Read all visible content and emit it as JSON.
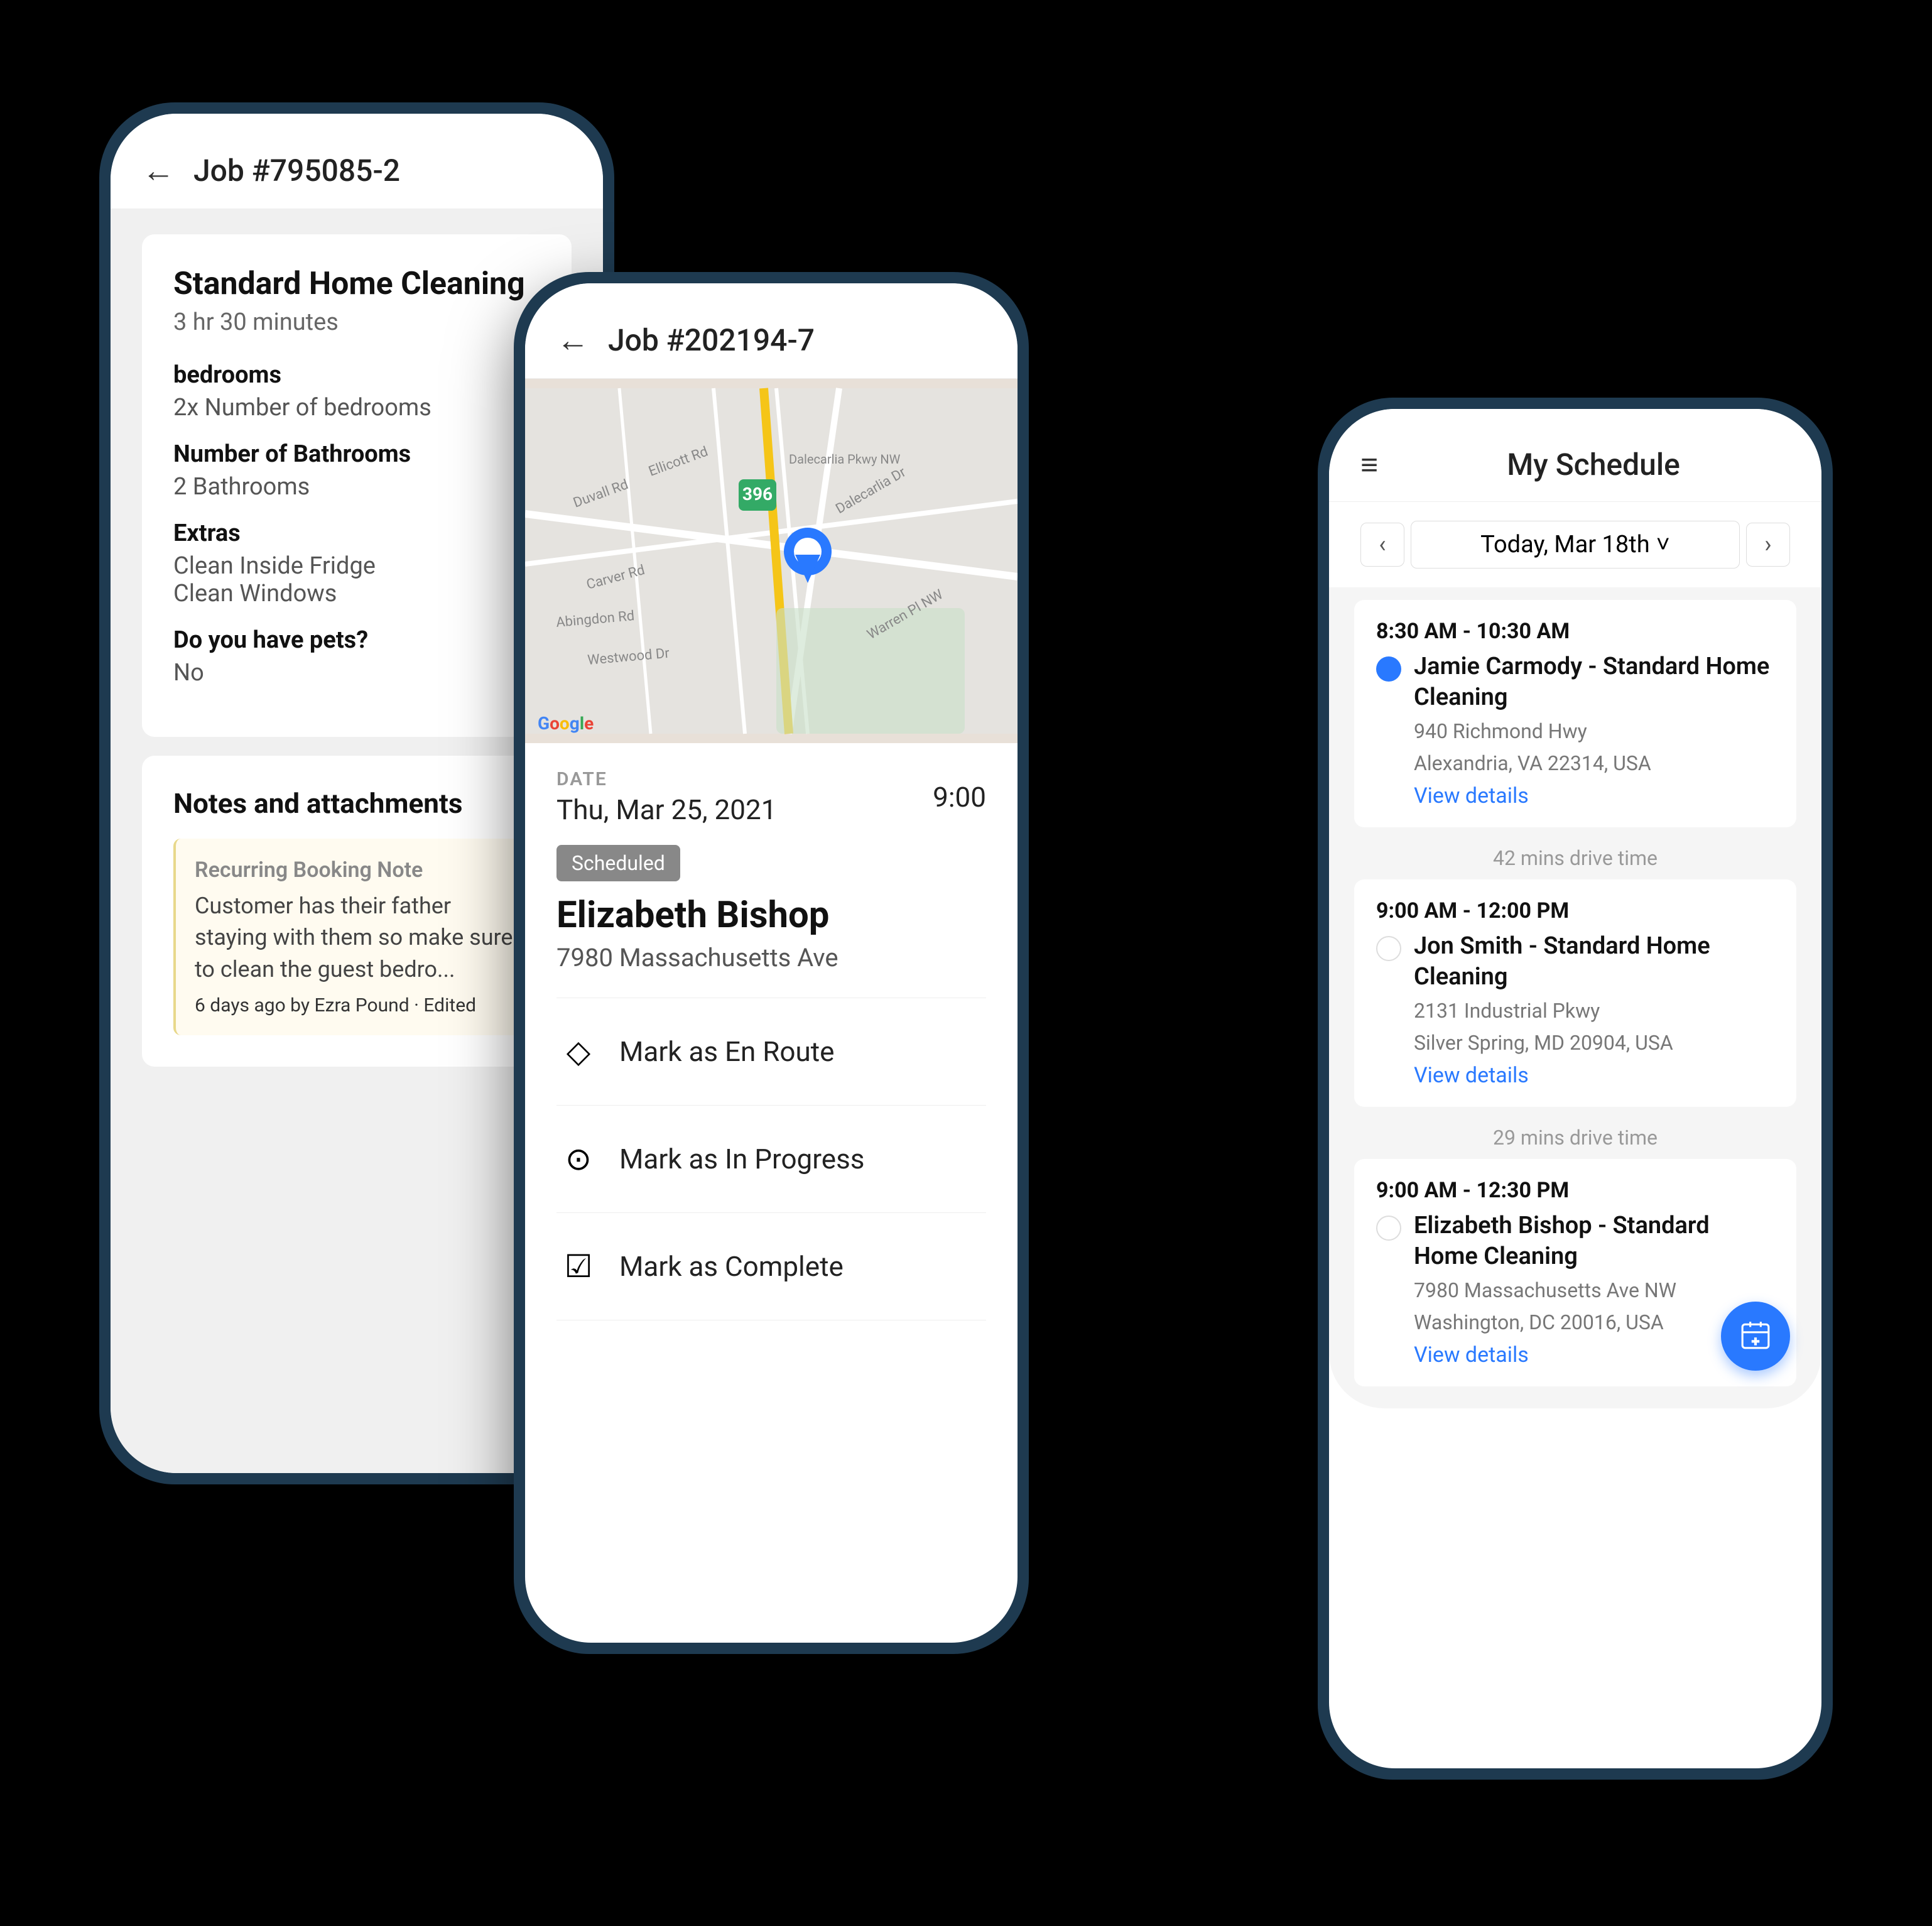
{
  "phone1": {
    "header": {
      "back_label": "←",
      "title": "Job #795085-2"
    },
    "job": {
      "name": "Standard Home Cleaning",
      "duration": "3 hr 30 minutes",
      "sections": [
        {
          "label": "bedrooms",
          "value": "2x Number of bedrooms"
        },
        {
          "label": "Number of Bathrooms",
          "value": "2 Bathrooms"
        },
        {
          "label": "Extras",
          "values": [
            "Clean Inside Fridge",
            "Clean Windows"
          ]
        },
        {
          "label": "Do you have pets?",
          "value": "No"
        }
      ]
    },
    "notes": {
      "title": "Notes and attachments",
      "item": {
        "label": "Recurring Booking Note",
        "text": "Customer has their father staying with them so make sure to clean the guest bedro...",
        "meta_time": "6 days ago",
        "meta_by": "by",
        "meta_author": "Ezra Pound",
        "meta_edited": "· Edited"
      }
    }
  },
  "phone2": {
    "header": {
      "back_label": "←",
      "title": "Job #202194-7"
    },
    "date_label": "DATE",
    "date_value": "Thu, Mar 25, 2021",
    "time_value": "9:00",
    "status": "Scheduled",
    "customer_name": "Elizabeth Bishop",
    "customer_address": "7980 Massachusetts Ave",
    "actions": [
      {
        "icon": "◇",
        "label": "Mark as En Route"
      },
      {
        "icon": "⏱",
        "label": "Mark as In Progress"
      },
      {
        "icon": "✓",
        "label": "Mark as Complete"
      }
    ]
  },
  "phone3": {
    "header": {
      "hamburger": "≡",
      "title": "My Schedule"
    },
    "date_nav": {
      "prev": "‹",
      "label": "Today, Mar 18th",
      "chevron": "˅",
      "next": "›"
    },
    "appointments": [
      {
        "time_range": "8:30 AM - 10:30 AM",
        "status": "active",
        "customer": "Jamie Carmody - Standard Home Cleaning",
        "address_line1": "940 Richmond Hwy",
        "address_line2": "Alexandria, VA 22314, USA",
        "view_details": "View details"
      },
      {
        "drive_time": "42 mins drive time"
      },
      {
        "time_range": "9:00 AM - 12:00 PM",
        "status": "inactive",
        "customer": "Jon Smith - Standard Home Cleaning",
        "address_line1": "2131 Industrial Pkwy",
        "address_line2": "Silver Spring, MD 20904, USA",
        "view_details": "View details"
      },
      {
        "drive_time": "29 mins drive time"
      },
      {
        "time_range": "9:00 AM - 12:30 PM",
        "status": "inactive",
        "customer": "Elizabeth Bishop - Standard Home Cleaning",
        "address_line1": "7980 Massachusetts Ave NW",
        "address_line2": "Washington, DC 20016, USA",
        "view_details": "View details"
      }
    ],
    "fab_icon": "+"
  }
}
